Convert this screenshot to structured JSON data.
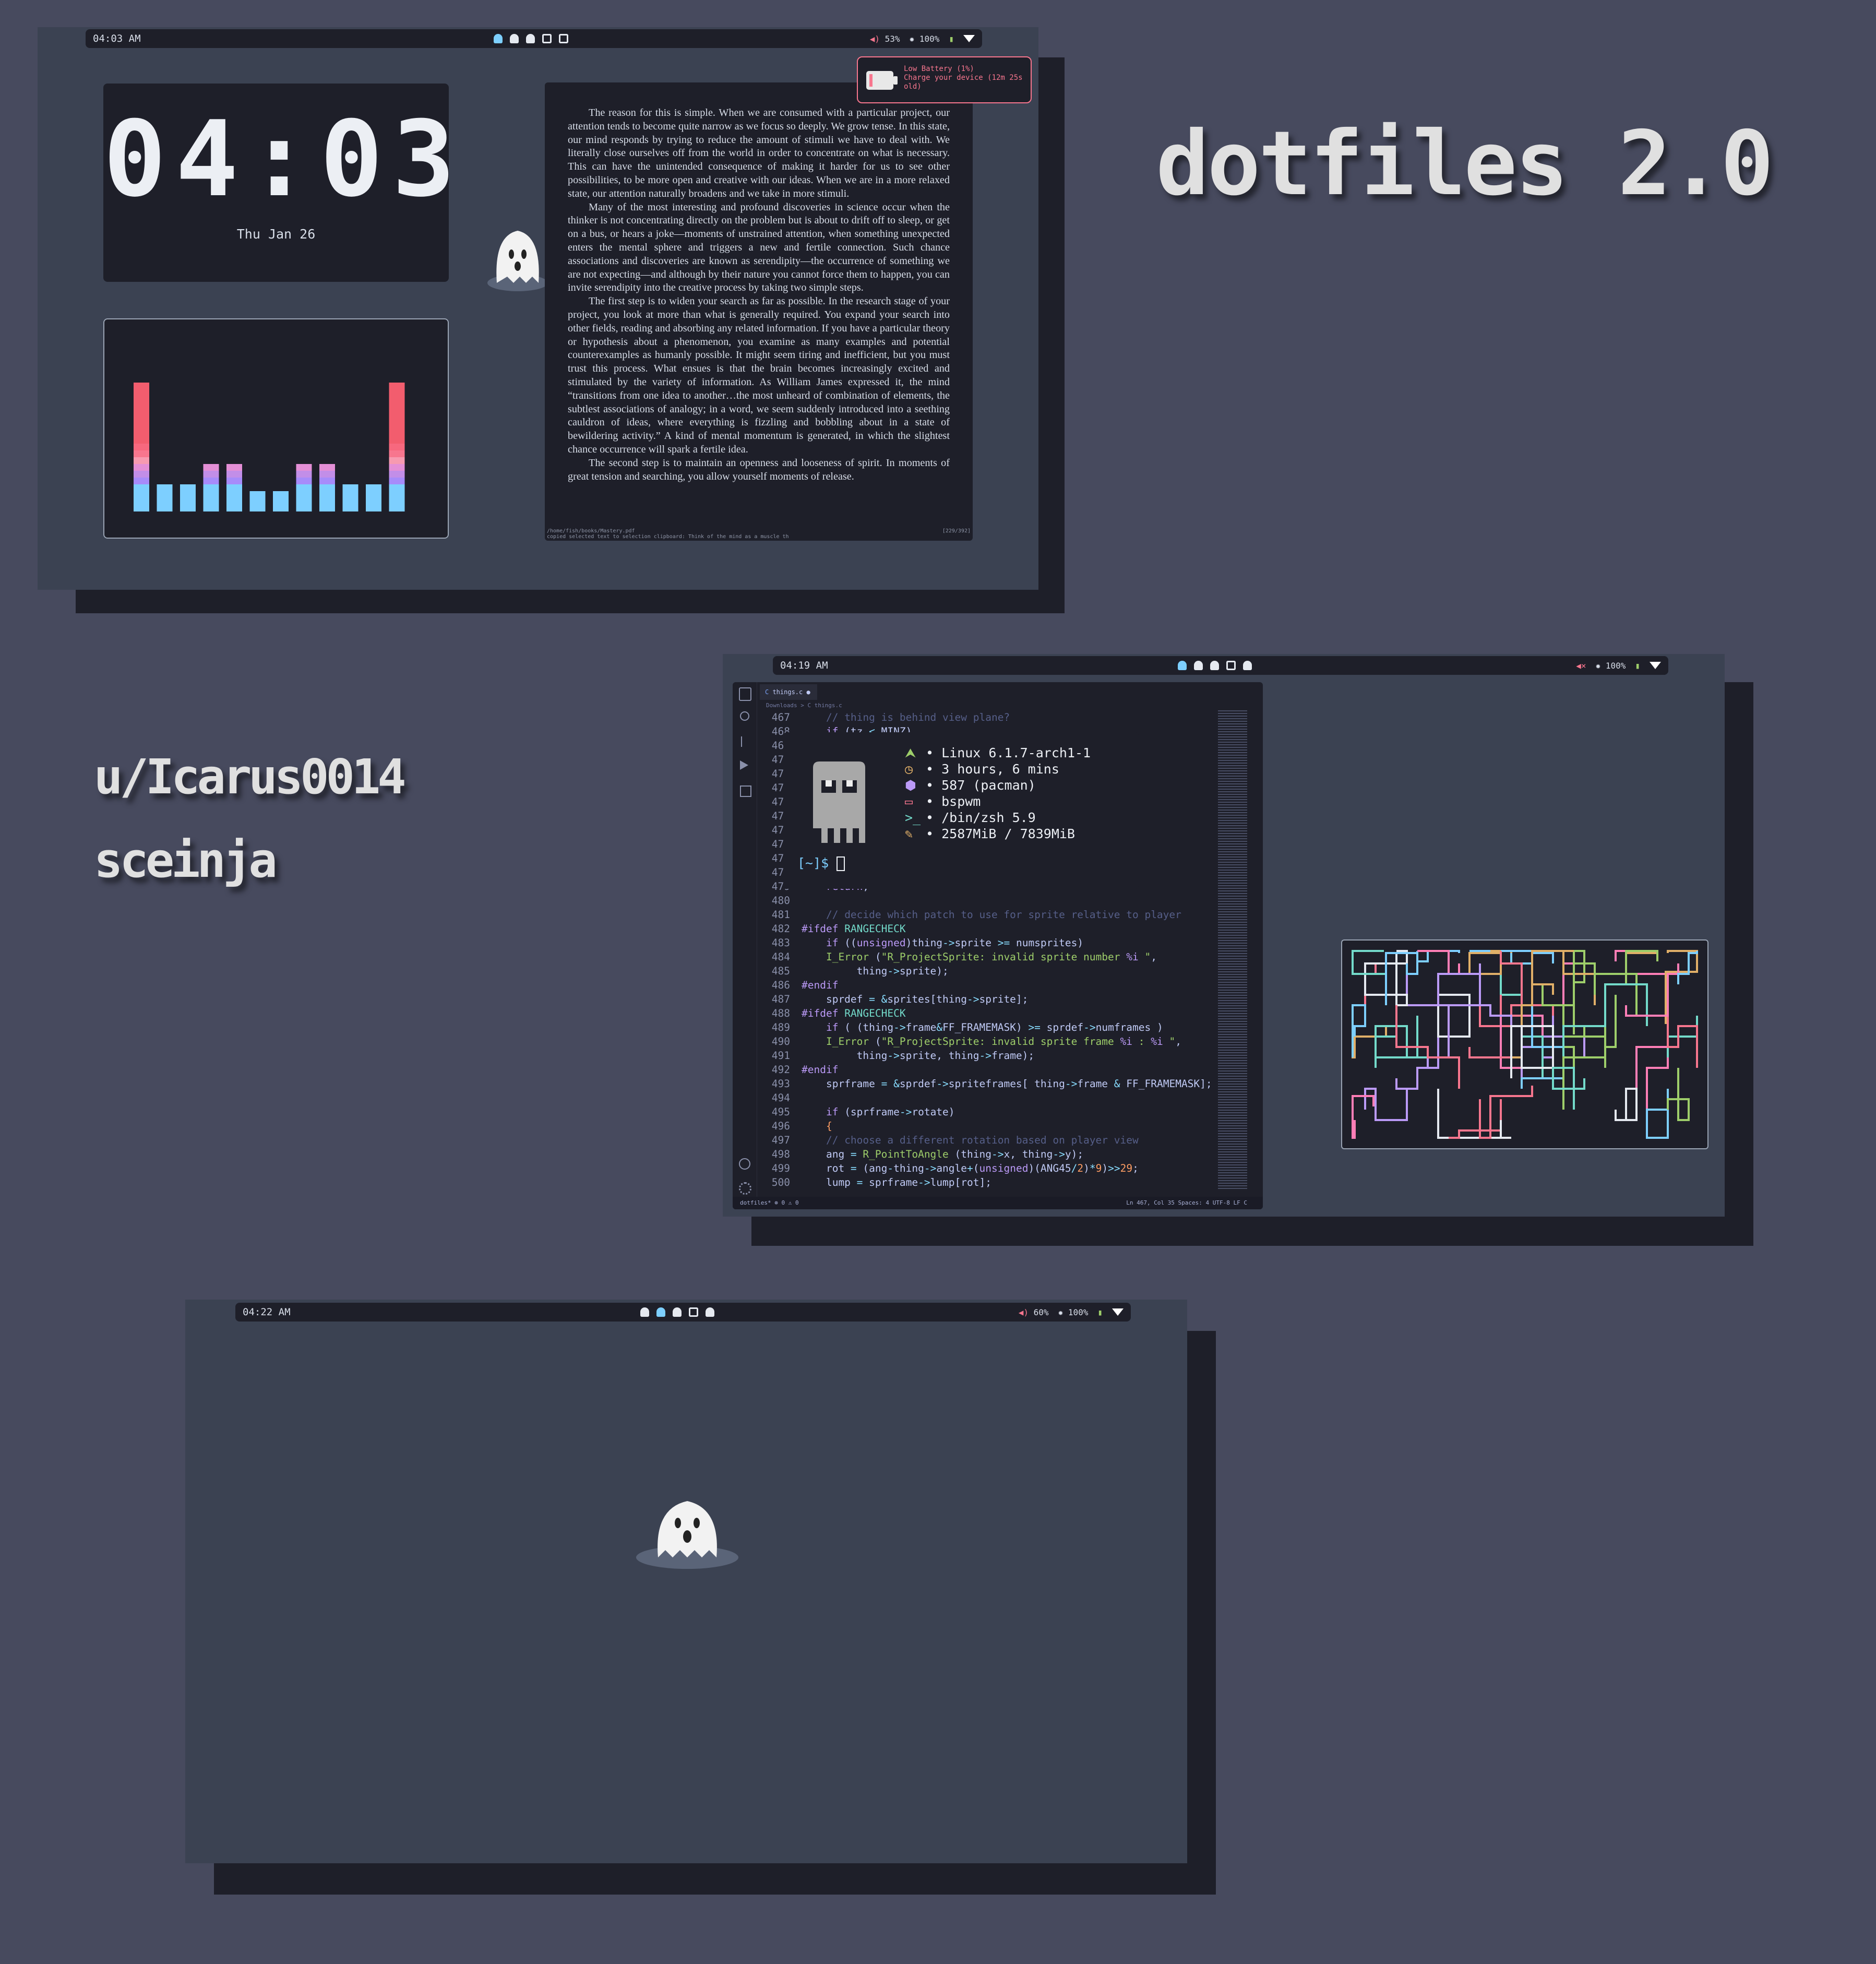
{
  "title": "dotfiles 2.0",
  "author": "u/Icarus0014",
  "author2": "sceinja",
  "screen1": {
    "time": "04:03 AM",
    "volume": "53%",
    "brightness": "100%",
    "clock": "04:03",
    "date": "Thu Jan 26",
    "notification": {
      "title": "Low Battery (1%)",
      "body": "Charge your device (12m 25s old)"
    },
    "reader": {
      "paragraphs": [
        "The reason for this is simple. When we are consumed with a particular project, our attention tends to become quite narrow as we focus so deeply. We grow tense. In this state, our mind responds by trying to reduce the amount of stimuli we have to deal with. We literally close ourselves off from the world in order to concentrate on what is necessary. This can have the unintended consequence of making it harder for us to see other possibilities, to be more open and creative with our ideas. When we are in a more relaxed state, our attention naturally broadens and we take in more stimuli.",
        "Many of the most interesting and profound discoveries in science occur when the thinker is not concentrating directly on the problem but is about to drift off to sleep, or get on a bus, or hears a joke—moments of unstrained attention, when something unexpected enters the mental sphere and triggers a new and fertile connection. Such chance associations and discoveries are known as serendipity—the occurrence of something we are not expecting—and although by their nature you cannot force them to happen, you can invite serendipity into the creative process by taking two simple steps.",
        "The first step is to widen your search as far as possible. In the research stage of your project, you look at more than what is generally required. You expand your search into other fields, reading and absorbing any related information. If you have a particular theory or hypothesis about a phenomenon, you examine as many examples and potential counterexamples as humanly possible. It might seem tiring and inefficient, but you must trust this process. What ensues is that the brain becomes increasingly excited and stimulated by the variety of information. As William James expressed it, the mind “transitions from one idea to another…the most unheard of combination of elements, the subtlest associations of analogy; in a word, we seem suddenly introduced into a seething cauldron of ideas, where everything is fizzling and bobbling about in a state of bewildering activity.” A kind of mental momentum is generated, in which the slightest chance occurrence will spark a fertile idea.",
        "The second step is to maintain an openness and looseness of spirit. In moments of great tension and searching, you allow yourself moments of release."
      ],
      "path": "/home/fish/books/Mastery.pdf",
      "status": "copied selected text to selection clipboard: Think of the mind as a muscle th",
      "page": "[229/392]"
    },
    "eq_levels": [
      1.0,
      0.2,
      0.2,
      0.38,
      0.38,
      0.13,
      0.13,
      0.38,
      0.38,
      0.2,
      0.2,
      1.0
    ]
  },
  "screen2": {
    "time": "04:19 AM",
    "brightness": "100%",
    "editor": {
      "tab": "things.c",
      "breadcrumb": "Downloads > C things.c",
      "status_left": "dotfiles*   ⊗ 0 ⚠ 0",
      "status_right": "Ln 467, Col 35   Spaces: 4   UTF-8   LF   C"
    },
    "fetch": [
      {
        "icon": "arch-icon",
        "color": "#9ece6a",
        "text": "• Linux 6.1.7-arch1-1"
      },
      {
        "icon": "clock-icon",
        "color": "#e0af68",
        "text": "• 3 hours, 6 mins"
      },
      {
        "icon": "package-icon",
        "color": "#bb9af7",
        "text": "• 587 (pacman)"
      },
      {
        "icon": "window-icon",
        "color": "#f7768e",
        "text": "• bspwm"
      },
      {
        "icon": "terminal-icon",
        "color": "#73daca",
        "text": "• /bin/zsh 5.9"
      },
      {
        "icon": "memory-icon",
        "color": "#e0af68",
        "text": "• 2587MiB / 7839MiB"
      }
    ],
    "prompt": "[~]$"
  },
  "screen3": {
    "time": "04:22 AM",
    "volume": "60%",
    "brightness": "100%"
  },
  "colors": {
    "accent": "#7dcfff",
    "bg": "#3b4252",
    "dark": "#1e1f29",
    "alert": "#f7768e"
  }
}
